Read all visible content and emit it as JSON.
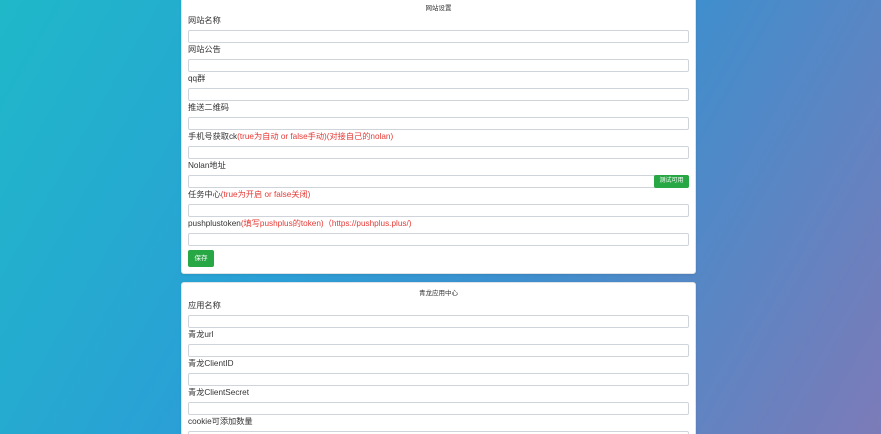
{
  "site_settings": {
    "title": "网站设置",
    "fields": [
      {
        "label": "网站名称",
        "hint": "",
        "value": ""
      },
      {
        "label": "网站公告",
        "hint": "",
        "value": ""
      },
      {
        "label": "qq群",
        "hint": "",
        "value": ""
      },
      {
        "label": "推送二维码",
        "hint": "",
        "value": ""
      },
      {
        "label": "手机号获取ck",
        "hint": "(true为自动 or false手动)(对接自己的nolan)",
        "value": ""
      },
      {
        "label": "Nolan地址",
        "hint": "",
        "value": "",
        "button": "测试可用"
      },
      {
        "label": "任务中心",
        "hint": "(true为开启 or false关闭)",
        "value": ""
      },
      {
        "label": "pushplustoken",
        "hint": "(填写pushplus的token)（https://pushplus.plus/)",
        "value": ""
      }
    ],
    "save_label": "保存"
  },
  "qinglong_settings": {
    "title": "青龙应用中心",
    "fields": [
      {
        "label": "应用名称",
        "value": ""
      },
      {
        "label": "青龙url",
        "value": ""
      },
      {
        "label": "青龙ClientID",
        "value": ""
      },
      {
        "label": "青龙ClientSecret",
        "value": ""
      },
      {
        "label": "cookie可添加数量",
        "value": ""
      }
    ]
  }
}
